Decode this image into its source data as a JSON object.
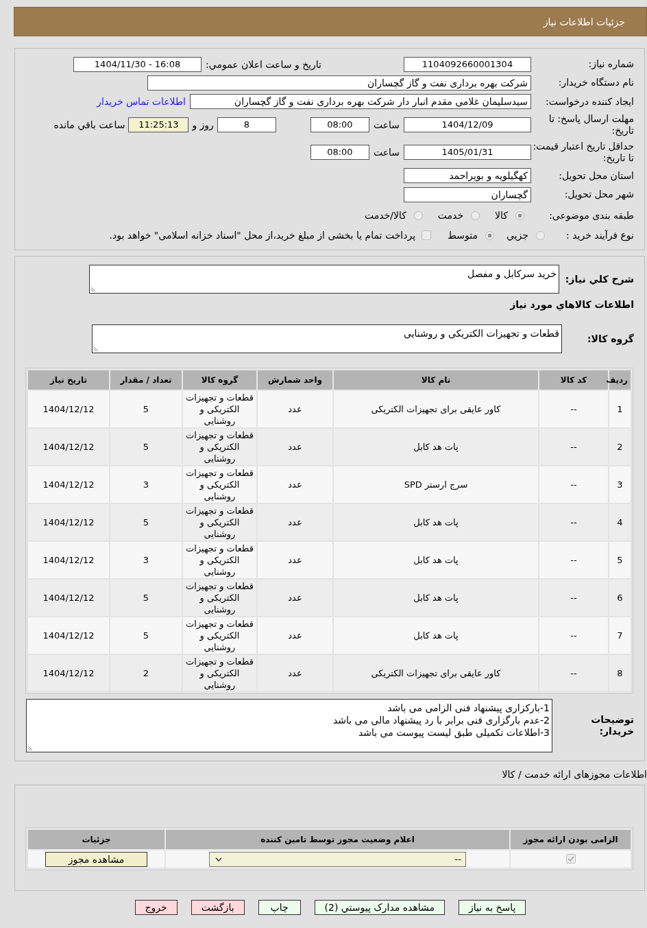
{
  "header": {
    "title": "جزئیات اطلاعات نیاز"
  },
  "info": {
    "need_number": {
      "label": "شماره نیاز:",
      "value": "1104092660001304"
    },
    "announcement": {
      "label": "تاریخ و ساعت اعلان عمومي:",
      "value": "1404/11/30 - 16:08"
    },
    "buyer_org": {
      "label": "نام دستگاه خریدار:",
      "value": "شرکت بهره برداری نفت و گاز گچساران"
    },
    "requester": {
      "label": "ایجاد کننده درخواست:",
      "value": "سیدسلیمان غلامی مقدم انبار دار شرکت بهره برداری نفت و گاز گچساران",
      "contact_link": "اطلاعات تماس خریدار"
    },
    "reply_deadline": {
      "label": "مهلت ارسال پاسخ: تا تاریخ:",
      "date": "1404/12/09",
      "time_label": "ساعت",
      "time": "08:00",
      "days": "8",
      "days_label": "روز و",
      "remaining": "11:25:13",
      "remaining_label": "ساعت باقي مانده"
    },
    "price_validity": {
      "label": "حداقل تاریخ اعتبار قیمت: تا تاریخ:",
      "date": "1405/01/31",
      "time_label": "ساعت",
      "time": "08:00"
    },
    "province": {
      "label": "استان محل تحویل:",
      "value": "کهگیلویه و بویراحمد"
    },
    "city": {
      "label": "شهر محل تحویل:",
      "value": "گچساران"
    },
    "category": {
      "label": "طبقه بندی موضوعی:",
      "options": [
        {
          "label": "کالا",
          "selected": true
        },
        {
          "label": "خدمت",
          "selected": false
        },
        {
          "label": "کالا/خدمت",
          "selected": false
        }
      ]
    },
    "process": {
      "label": "نوع فرآیند خرید :",
      "options": [
        {
          "label": "جزيي",
          "selected": false
        },
        {
          "label": "متوسط",
          "selected": true
        }
      ],
      "treasury": {
        "label": "پرداخت تمام یا بخشی از مبلغ خرید،از محل \"اسناد خزانه اسلامی\" خواهد بود.",
        "checked": false
      }
    }
  },
  "details": {
    "description": {
      "label": "شرح کلي نیاز:",
      "value": "خرید سرکابل و مفصل"
    },
    "goods_heading": "اطلاعات کالاهاي مورد نیاز",
    "goods_group": {
      "label": "گروه کالا:",
      "value": "قطعات و تجهیزات الکتریکی و روشنایی"
    },
    "table": {
      "columns": [
        "ردیف",
        "کد کالا",
        "نام کالا",
        "واحد شمارش",
        "گروه کالا",
        "تعداد / مقدار",
        "تاریخ نیاز"
      ],
      "rows": [
        [
          "1",
          "--",
          "کاور عایقی برای تجهیزات الکتریکی",
          "عدد",
          "قطعات و تجهیزات الکتریکی و روشنایی",
          "5",
          "1404/12/12"
        ],
        [
          "2",
          "--",
          "پات هد کابل",
          "عدد",
          "قطعات و تجهیزات الکتریکی و روشنایی",
          "5",
          "1404/12/12"
        ],
        [
          "3",
          "--",
          "سرج ارستر SPD",
          "عدد",
          "قطعات و تجهیزات الکتریکی و روشنایی",
          "3",
          "1404/12/12"
        ],
        [
          "4",
          "--",
          "پات هد کابل",
          "عدد",
          "قطعات و تجهیزات الکتریکی و روشنایی",
          "5",
          "1404/12/12"
        ],
        [
          "5",
          "--",
          "پات هد کابل",
          "عدد",
          "قطعات و تجهیزات الکتریکی و روشنایی",
          "3",
          "1404/12/12"
        ],
        [
          "6",
          "--",
          "پات هد کابل",
          "عدد",
          "قطعات و تجهیزات الکتریکی و روشنایی",
          "5",
          "1404/12/12"
        ],
        [
          "7",
          "--",
          "پات هد کابل",
          "عدد",
          "قطعات و تجهیزات الکتریکی و روشنایی",
          "5",
          "1404/12/12"
        ],
        [
          "8",
          "--",
          "کاور عایقی برای تجهیزات الکتریکی",
          "عدد",
          "قطعات و تجهیزات الکتریکی و روشنایی",
          "2",
          "1404/12/12"
        ]
      ]
    },
    "notes": {
      "label": "توضیحات خریدار:",
      "lines": [
        "1-بارکزاری پیشنهاد فنی الزامی می باشد",
        "2-عدم بارگزاری فنی برابر با رد پیشنهاد مالی می باشد",
        "3-اطلاعات تکمیلی طبق لیست پیوست می باشد"
      ]
    }
  },
  "licenses": {
    "title": "اطلاعات مجوزهای ارائه خدمت / کالا",
    "columns": [
      "الزامی بودن ارائه مجوز",
      "اعلام وضعیت مجوز توسط تامین کننده",
      "جزئیات"
    ],
    "rows": [
      {
        "required": true,
        "status": "--",
        "button": "مشاهده مجوز"
      }
    ]
  },
  "buttons": [
    {
      "label": "پاسخ به نیاز",
      "color": "#ecfcec"
    },
    {
      "label": "مشاهده مدارک پیوستي (2)",
      "color": "#ecfcec"
    },
    {
      "label": "چاپ",
      "color": "#ecfcec"
    },
    {
      "label": "بازگشت",
      "color": "#ffd9dc"
    },
    {
      "label": "خروج",
      "color": "#ffd9dc"
    }
  ]
}
